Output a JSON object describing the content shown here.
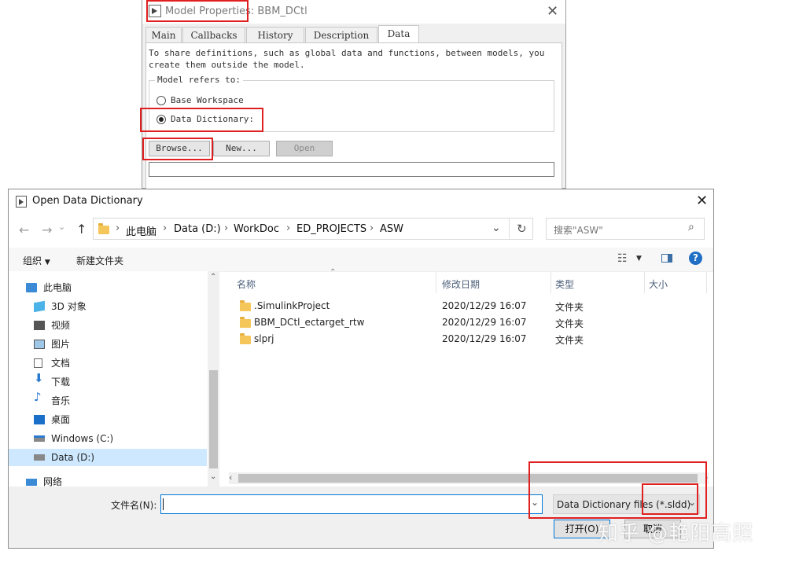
{
  "model_properties": {
    "title": "Model Properties: BBM_DCtl",
    "tabs": [
      "Main",
      "Callbacks",
      "History",
      "Description",
      "Data"
    ],
    "active_tab": "Data",
    "description": "To share definitions, such as global data and functions, between models, you create them outside the model.",
    "group_label": "Model refers to:",
    "options": [
      "Base Workspace",
      "Data Dictionary:"
    ],
    "selected_option": "Data Dictionary:",
    "buttons": {
      "browse": "Browse...",
      "new": "New...",
      "open": "Open"
    },
    "path_value": ""
  },
  "open_dialog": {
    "title": "Open Data Dictionary",
    "breadcrumb": [
      "此电脑",
      "Data (D:)",
      "WorkDoc",
      "ED_PROJECTS",
      "ASW"
    ],
    "search_placeholder": "搜索\"ASW\"",
    "toolbar": {
      "organize": "组织",
      "new_folder": "新建文件夹"
    },
    "nav_items": [
      "此电脑",
      "3D 对象",
      "视频",
      "图片",
      "文档",
      "下载",
      "音乐",
      "桌面",
      "Windows (C:)",
      "Data (D:)",
      "网络"
    ],
    "selected_nav": "Data (D:)",
    "columns": {
      "name": "名称",
      "modified": "修改日期",
      "type": "类型",
      "size": "大小"
    },
    "files": [
      {
        "name": ".SimulinkProject",
        "modified": "2020/12/29 16:07",
        "type": "文件夹",
        "size": ""
      },
      {
        "name": "BBM_DCtl_ectarget_rtw",
        "modified": "2020/12/29 16:07",
        "type": "文件夹",
        "size": ""
      },
      {
        "name": "slprj",
        "modified": "2020/12/29 16:07",
        "type": "文件夹",
        "size": ""
      }
    ],
    "filename_label": "文件名(N):",
    "filename_value": "",
    "filetype": "Data Dictionary files (*.sldd)",
    "open_button": "打开(O)",
    "cancel_button": "取消"
  },
  "watermark": "知乎 @艳阳高照",
  "colors": {
    "highlight_red": "#e02020",
    "selection_blue": "#cde8ff",
    "focus_blue": "#0078d7"
  }
}
